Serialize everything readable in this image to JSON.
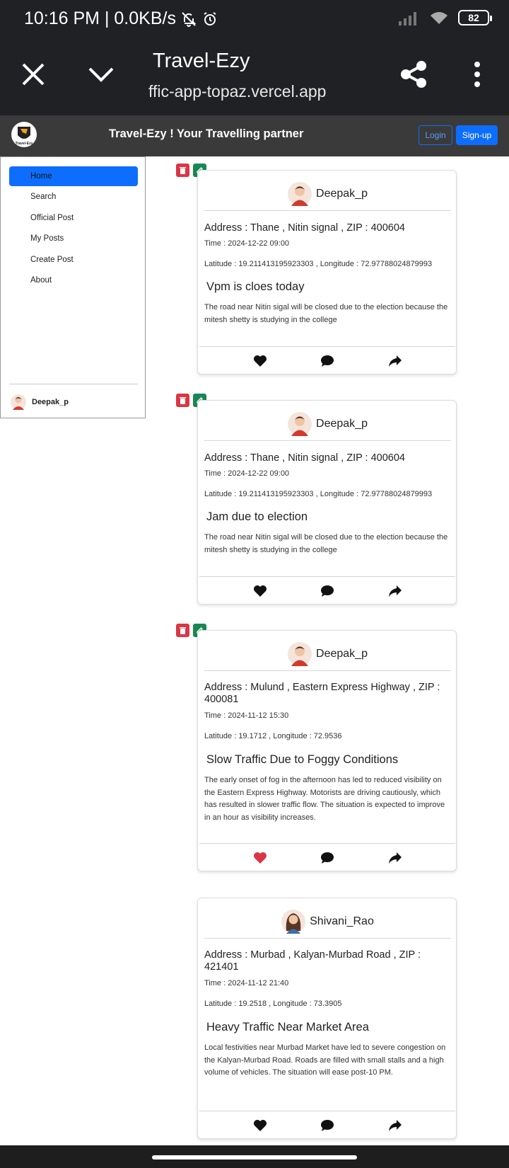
{
  "status_bar": {
    "time_speed": "10:16 PM | 0.0KB/s",
    "battery": "82"
  },
  "browser": {
    "title": "Travel-Ezy",
    "url": "ffic-app-topaz.vercel.app"
  },
  "header": {
    "logo_text": "Travel-Ezy",
    "brand": "Travel-Ezy ! Your Travelling partner",
    "login_label": "Login",
    "signup_label": "Sign-up"
  },
  "sidebar": {
    "items": [
      {
        "label": "Home"
      },
      {
        "label": "Search"
      },
      {
        "label": "Official Post"
      },
      {
        "label": "My Posts"
      },
      {
        "label": "Create Post"
      },
      {
        "label": "About"
      }
    ],
    "user": "Deepak_p"
  },
  "posts": [
    {
      "user": "Deepak_p",
      "address": "Address : Thane , Nitin signal , ZIP : 400604",
      "time": "Time : 2024-12-22 09:00",
      "coords": "Latitude : 19.211413195923303 , Longitude : 72.97788024879993",
      "title": "Vpm is cloes today",
      "description": "The road near Nitin sigal will be closed due to the election because the mitesh shetty is studying in the college",
      "liked": false
    },
    {
      "user": "Deepak_p",
      "address": "Address : Thane , Nitin signal , ZIP : 400604",
      "time": "Time : 2024-12-22 09:00",
      "coords": "Latitude : 19.211413195923303 , Longitude : 72.97788024879993",
      "title": "Jam due to election",
      "description": "The road near Nitin sigal will be closed due to the election because the mitesh shetty is studying in the college",
      "liked": false
    },
    {
      "user": "Deepak_p",
      "address": "Address : Mulund , Eastern Express Highway , ZIP : 400081",
      "time": "Time : 2024-11-12 15:30",
      "coords": "Latitude : 19.1712 , Longitude : 72.9536",
      "title": "Slow Traffic Due to Foggy Conditions",
      "description": "The early onset of fog in the afternoon has led to reduced visibility on the Eastern Express Highway. Motorists are driving cautiously, which has resulted in slower traffic flow. The situation is expected to improve in an hour as visibility increases.",
      "liked": true
    },
    {
      "user": "Shivani_Rao",
      "address": "Address : Murbad , Kalyan-Murbad Road , ZIP : 421401",
      "time": "Time : 2024-11-12 21:40",
      "coords": "Latitude : 19.2518 , Longitude : 73.3905",
      "title": "Heavy Traffic Near Market Area",
      "description": "Local festivities near Murbad Market have led to severe congestion on the Kalyan-Murbad Road. Roads are filled with small stalls and a high volume of vehicles. The situation will ease post-10 PM.",
      "liked": false
    }
  ],
  "colors": {
    "accent": "#0d6efd",
    "like_active": "#dc3545",
    "delete": "#dc3545",
    "edit": "#198754",
    "header_bg": "#3a3a3a",
    "chrome_bg": "#202124"
  }
}
